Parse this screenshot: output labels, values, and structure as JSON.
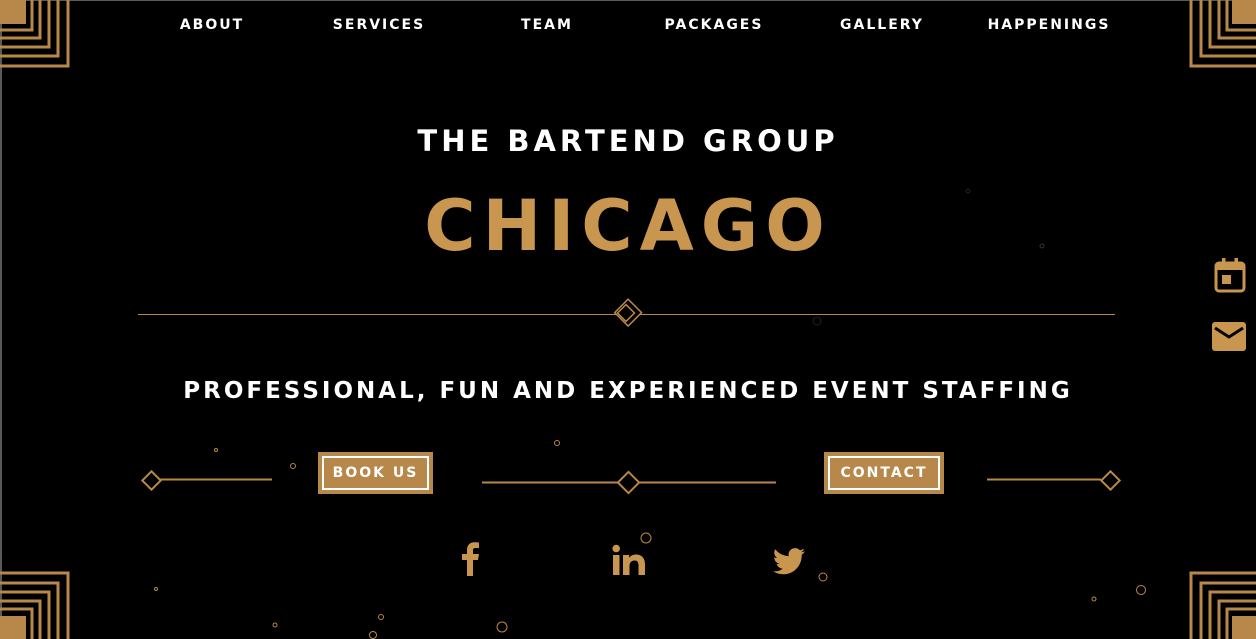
{
  "nav": {
    "items": [
      {
        "label": "ABOUT"
      },
      {
        "label": "SERVICES"
      },
      {
        "label": "TEAM"
      },
      {
        "label": "PACKAGES"
      },
      {
        "label": "GALLERY"
      },
      {
        "label": "HAPPENINGS"
      }
    ]
  },
  "hero": {
    "title": "THE BARTEND GROUP",
    "city": "CHICAGO",
    "tagline": "PROFESSIONAL, FUN AND EXPERIENCED EVENT STAFFING"
  },
  "buttons": {
    "book_label": "BOOK US",
    "contact_label": "CONTACT"
  },
  "social": {
    "facebook": "facebook-icon",
    "linkedin": "linkedin-icon",
    "twitter": "twitter-icon"
  },
  "side": {
    "calendar": "calendar-icon",
    "mail": "mail-icon"
  },
  "colors": {
    "background": "#000000",
    "gold": "#c9964f",
    "button_gold": "#b8884a",
    "text": "#ffffff"
  }
}
